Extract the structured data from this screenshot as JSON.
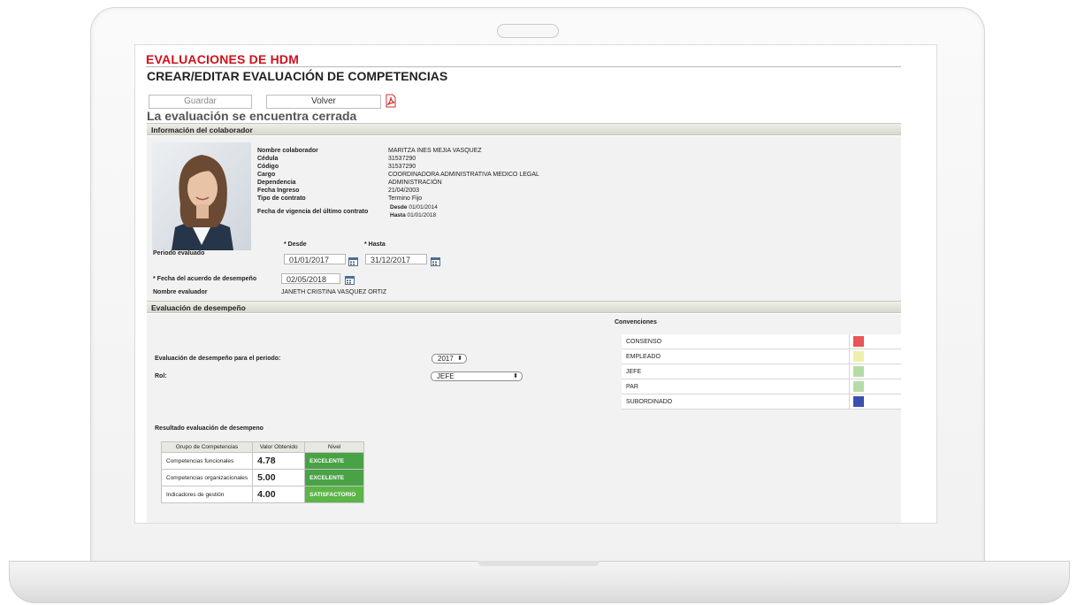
{
  "app": {
    "title": "EVALUACIONES DE HDM",
    "page_title": "CREAR/EDITAR EVALUACIÓN DE COMPETENCIAS"
  },
  "toolbar": {
    "save_label": "Guardar",
    "back_label": "Volver",
    "pdf_icon": "pdf-icon"
  },
  "status_message": "La evaluación se encuentra cerrada",
  "collaborator_section": {
    "title": "Información del colaborador",
    "fields": [
      {
        "label": "Nombre colaborador",
        "value": "MARITZA INES MEJIA VASQUEZ"
      },
      {
        "label": "Cédula",
        "value": "31537290"
      },
      {
        "label": "Código",
        "value": "31537290"
      },
      {
        "label": "Cargo",
        "value": "COORDINADORA ADMINISTRATIVA MEDICO LEGAL"
      },
      {
        "label": "Dependencia",
        "value": "ADMINISTRACIÓN"
      },
      {
        "label": "Fecha Ingreso",
        "value": "21/04/2003"
      },
      {
        "label": "Tipo de contrato",
        "value": "Termino Fijo"
      }
    ],
    "contract_validity": {
      "label": "Fecha de vigencia del último contrato",
      "from_label": "Desde",
      "from_value": "01/01/2014",
      "to_label": "Hasta",
      "to_value": "01/01/2018"
    },
    "period": {
      "label": "Periodo evaluado",
      "from_label": "* Desde",
      "from_value": "01/01/2017",
      "to_label": "* Hasta",
      "to_value": "31/12/2017"
    },
    "agreement_date": {
      "label": "* Fecha del acuerdo de desempeño",
      "value": "02/05/2018"
    },
    "evaluator": {
      "label": "Nombre evaluador",
      "value": "JANETH CRISTINA VASQUEZ ORTIZ"
    }
  },
  "performance_section": {
    "title": "Evaluación de desempeño",
    "period_label": "Evaluación de desempeño para el periodo:",
    "period_value": "2017",
    "role_label": "Rol:",
    "role_value": "JEFE",
    "conventions": {
      "title": "Convenciones",
      "items": [
        {
          "label": "CONSENSO",
          "color": "#e8555a"
        },
        {
          "label": "EMPLEADO",
          "color": "#eef0a8"
        },
        {
          "label": "JEFE",
          "color": "#b6dca6"
        },
        {
          "label": "PAR",
          "color": "#b6dca6"
        },
        {
          "label": "SUBORDINADO",
          "color": "#3a4fae"
        }
      ]
    },
    "results": {
      "title": "Resultado evaluación de desempeno",
      "headers": [
        "Grupo de Competencias",
        "Valor Obtenido",
        "Nivel"
      ],
      "rows": [
        {
          "group": "Competencias funcionales",
          "value": "4.78",
          "level": "EXCELENTE",
          "level_color": "#4aa247"
        },
        {
          "group": "Competencias organizacionales",
          "value": "5.00",
          "level": "EXCELENTE",
          "level_color": "#4aa247"
        },
        {
          "group": "Indicadores de gestión",
          "value": "4.00",
          "level": "SATISFACTORIO",
          "level_color": "#5cb548"
        }
      ]
    }
  }
}
